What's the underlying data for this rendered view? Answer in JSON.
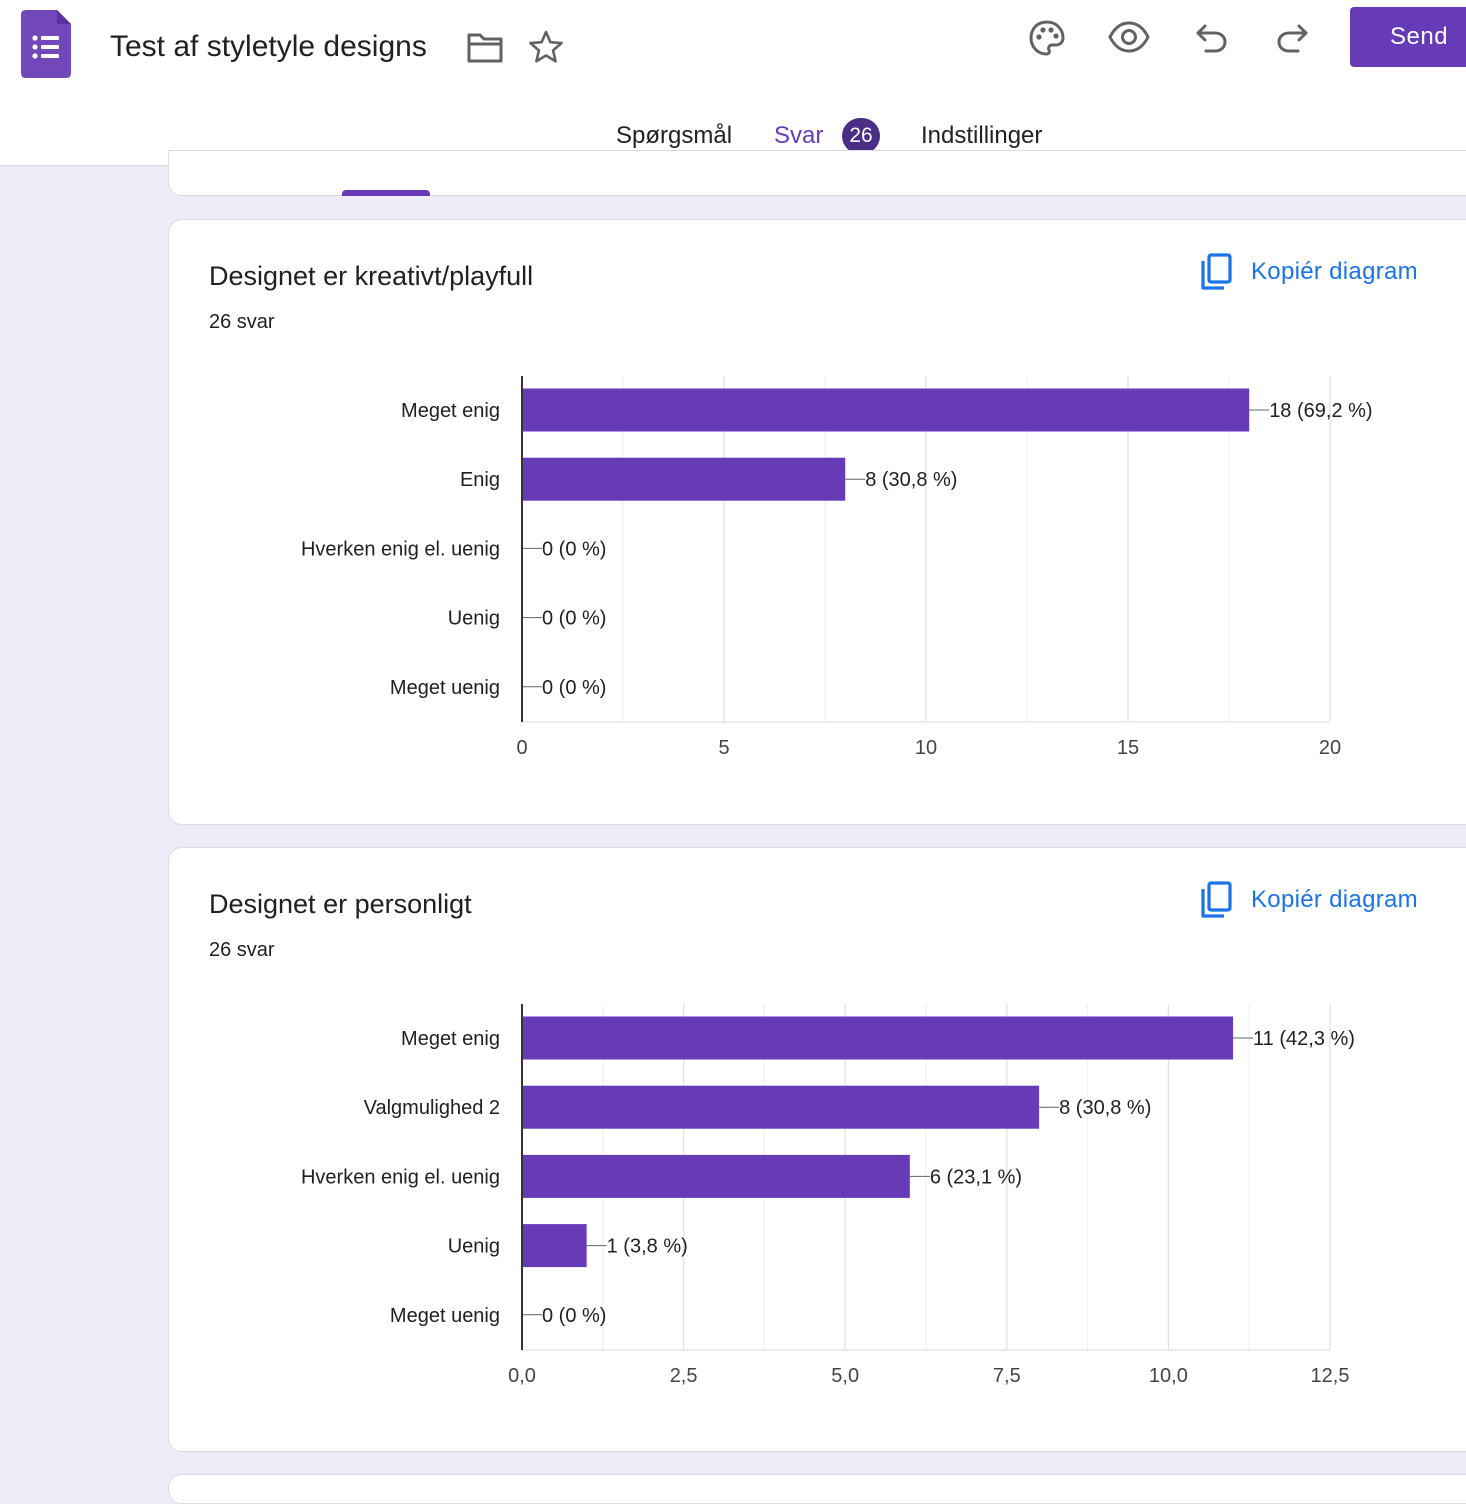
{
  "header": {
    "title": "Test af styletyle designs",
    "send_label": "Send",
    "accent_color": "#673ab7",
    "icons": [
      "forms-logo-icon",
      "folder-icon",
      "star-icon",
      "palette-icon",
      "eye-icon",
      "undo-icon",
      "redo-icon"
    ]
  },
  "tabs": {
    "questions_label": "Spørgsmål",
    "responses_label": "Svar",
    "responses_count": "26",
    "settings_label": "Indstillinger",
    "active": "Svar"
  },
  "copy_label": "Kopiér diagram",
  "bar_color": "#673ab7",
  "chart_data": [
    {
      "type": "bar",
      "orientation": "horizontal",
      "title": "Designet er kreativt/playfull",
      "subtitle": "26 svar",
      "categories": [
        "Meget enig",
        "Enig",
        "Hverken enig el. uenig",
        "Uenig",
        "Meget uenig"
      ],
      "values": [
        18,
        8,
        0,
        0,
        0
      ],
      "data_labels": [
        "18 (69,2 %)",
        "8 (30,8 %)",
        "0 (0 %)",
        "0 (0 %)",
        "0 (0 %)"
      ],
      "xlim": [
        0,
        20
      ],
      "xticks": [
        0,
        5,
        10,
        15,
        20
      ],
      "xtick_labels": [
        "0",
        "5",
        "10",
        "15",
        "20"
      ],
      "grid": true
    },
    {
      "type": "bar",
      "orientation": "horizontal",
      "title": "Designet er personligt",
      "subtitle": "26 svar",
      "categories": [
        "Meget enig",
        "Valgmulighed 2",
        "Hverken enig el. uenig",
        "Uenig",
        "Meget uenig"
      ],
      "values": [
        11,
        8,
        6,
        1,
        0
      ],
      "data_labels": [
        "11 (42,3 %)",
        "8 (30,8 %)",
        "6 (23,1 %)",
        "1 (3,8 %)",
        "0 (0 %)"
      ],
      "xlim": [
        0,
        12.5
      ],
      "xticks": [
        0,
        2.5,
        5,
        7.5,
        10,
        12.5
      ],
      "xtick_labels": [
        "0,0",
        "2,5",
        "5,0",
        "7,5",
        "10,0",
        "12,5"
      ],
      "grid": true
    }
  ]
}
